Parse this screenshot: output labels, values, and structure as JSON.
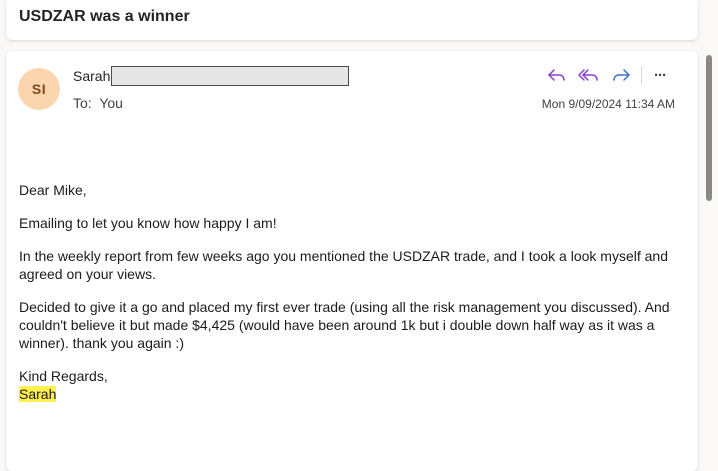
{
  "subject": "USDZAR was a winner",
  "message": {
    "avatar_initials": "SI",
    "sender_name": "Sarah",
    "to_label": "To:",
    "to_value": "You",
    "timestamp": "Mon 9/09/2024 11:34 AM",
    "actions": {
      "reply_icon": "reply-icon",
      "reply_all_icon": "reply-all-icon",
      "forward_icon": "forward-icon",
      "more_label": "···"
    },
    "body": {
      "greeting": "Dear  Mike,",
      "paragraph1": "Emailing to let you know how happy I am!",
      "paragraph2": "In the weekly report from few weeks ago you mentioned the USDZAR trade, and I took a look myself and agreed on your views.",
      "paragraph3": "Decided to give it a go and placed my first ever trade (using all the risk management you discussed). And couldn't believe it but made $4,425 (would have been around 1k but i double down half way as it was a winner). thank you again :)",
      "sign_off": "Kind Regards,",
      "signature": "Sarah"
    }
  },
  "colors": {
    "accent": "#8a3ed1",
    "forward": "#3a70c9",
    "avatar_bg": "#fbd5ae",
    "highlight": "#fff04d"
  }
}
